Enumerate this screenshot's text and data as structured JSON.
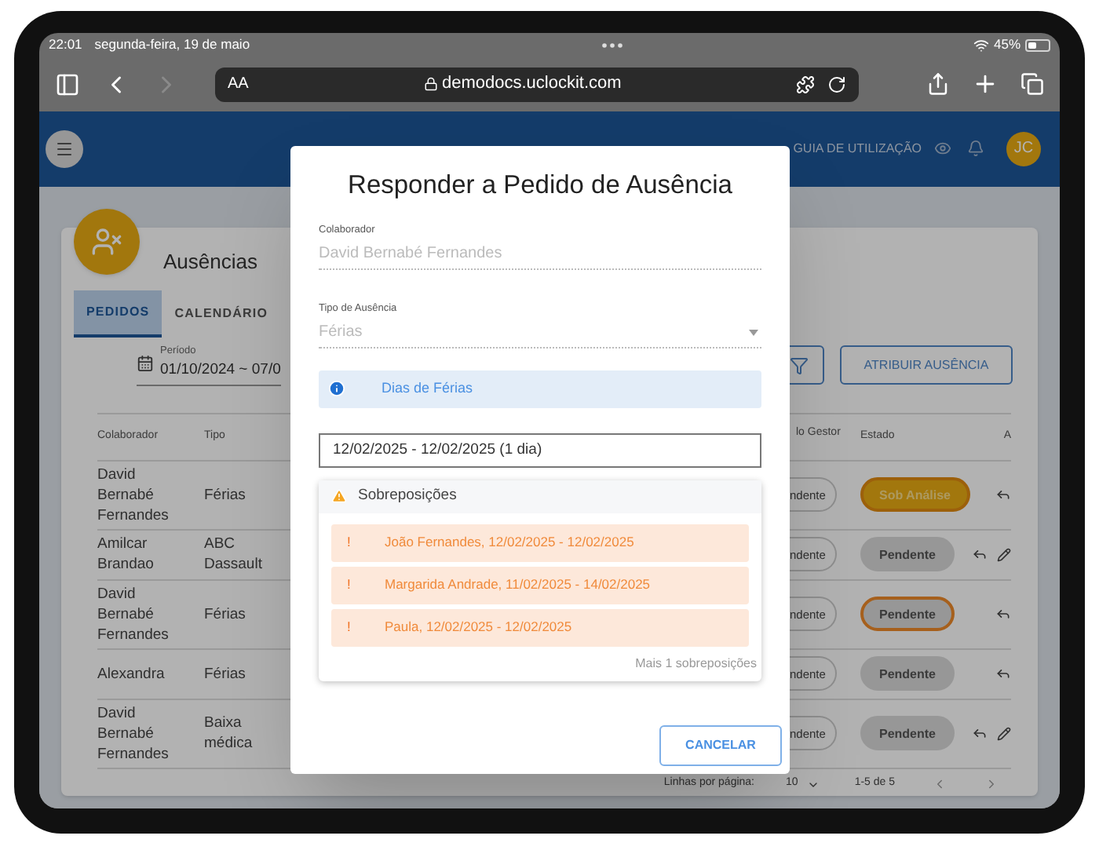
{
  "status_bar": {
    "time": "22:01",
    "date": "segunda-feira, 19 de maio",
    "battery": "45%"
  },
  "browser": {
    "text_size": "AA",
    "url": "demodocs.uclockit.com",
    "can_go_forward": false
  },
  "header": {
    "guide_link": "GUIA DE UTILIZAÇÃO",
    "avatar": "JC"
  },
  "page": {
    "title": "Ausências",
    "tabs": [
      {
        "label": "PEDIDOS",
        "selected": true
      },
      {
        "label": "CALENDÁRIO",
        "selected": false
      }
    ],
    "period": {
      "label": "Período",
      "value": "01/10/2024 ~ 07/0"
    },
    "assign_button": "ATRIBUIR AUSÊNCIA"
  },
  "table": {
    "columns": [
      "Colaborador",
      "Tipo",
      "lo Gestor",
      "Estado",
      "A"
    ],
    "rows": [
      {
        "colaborador": "David Bernabé Fernandes",
        "tipo": "Férias",
        "gestor": "ndente",
        "estado": "Sob Análise",
        "kind": "review",
        "editable": false
      },
      {
        "colaborador": "Amilcar Brandao",
        "tipo": "ABC Dassault",
        "gestor": "ndente",
        "estado": "Pendente",
        "kind": "pending",
        "editable": true
      },
      {
        "colaborador": "David Bernabé Fernandes",
        "tipo": "Férias",
        "gestor": "ndente",
        "estado": "Pendente",
        "kind": "highlighted",
        "editable": false
      },
      {
        "colaborador": "Alexandra",
        "tipo": "Férias",
        "gestor": "ndente",
        "estado": "Pendente",
        "kind": "pending",
        "editable": false
      },
      {
        "colaborador": "David Bernabé Fernandes",
        "tipo": "Baixa médica",
        "gestor": "ndente",
        "estado": "Pendente",
        "kind": "pending",
        "editable": true
      }
    ]
  },
  "pagination": {
    "rows_label": "Linhas por página:",
    "rows_value": "10",
    "range": "1-5 de 5"
  },
  "dialog": {
    "title": "Responder a Pedido de Ausência",
    "collaborator": {
      "label": "Colaborador",
      "value": "David Bernabé Fernandes",
      "disabled": true
    },
    "absence_type": {
      "label": "Tipo de Ausência",
      "value": "Férias",
      "disabled": true
    },
    "info": "Dias de Férias",
    "dates": "12/02/2025 - 12/02/2025 (1 dia)",
    "overlaps": {
      "title": "Sobreposições",
      "items": [
        {
          "mark": "!",
          "text": "João Fernandes, 12/02/2025 - 12/02/2025"
        },
        {
          "mark": "!",
          "text": "Margarida Andrade, 11/02/2025 - 14/02/2025"
        },
        {
          "mark": "!",
          "text": "Paula, 12/02/2025 - 12/02/2025"
        }
      ],
      "more": "Mais 1 sobreposições"
    },
    "cancel_button": "CANCELAR"
  }
}
